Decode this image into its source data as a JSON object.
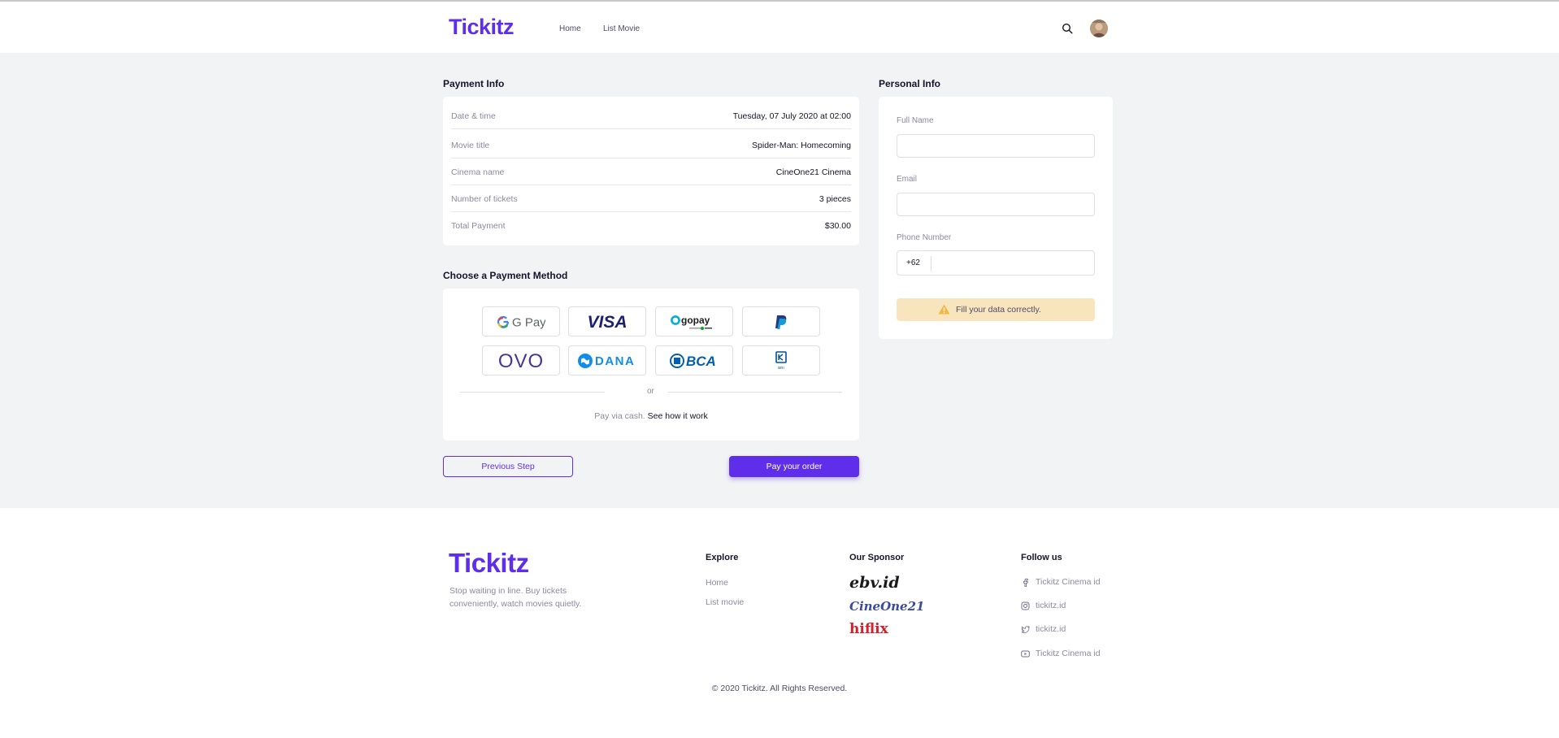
{
  "brand": {
    "name": "Tickitz",
    "color": "#5f2eea"
  },
  "navbar": {
    "links": [
      "Home",
      "List Movie"
    ],
    "search_icon": "search-icon",
    "avatar": "user-avatar"
  },
  "payment_info": {
    "title": "Payment Info",
    "rows": [
      {
        "label": "Date & time",
        "value": "Tuesday, 07 July 2020 at 02:00"
      },
      {
        "label": "Movie title",
        "value": "Spider-Man: Homecoming"
      },
      {
        "label": "Cinema name",
        "value": "CineOne21 Cinema"
      },
      {
        "label": "Number of tickets",
        "value": "3 pieces"
      },
      {
        "label": "Total Payment",
        "value": "$30.00"
      }
    ]
  },
  "payment_method": {
    "title": "Choose a Payment Method",
    "methods": [
      "G Pay",
      "VISA",
      "gopay",
      "PayPal",
      "OVO",
      "DANA",
      "BCA",
      "BRI"
    ],
    "divider_text": "or",
    "cash_text": "Pay via cash.",
    "cash_link": "See how it work"
  },
  "actions": {
    "previous": "Previous Step",
    "pay": "Pay your order"
  },
  "personal_info": {
    "title": "Personal Info",
    "full_name_label": "Full Name",
    "email_label": "Email",
    "phone_label": "Phone Number",
    "phone_prefix": "+62",
    "full_name_value": "",
    "email_value": "",
    "phone_value": "",
    "warning": "Fill your data correctly."
  },
  "footer": {
    "tagline": "Stop waiting in line. Buy tickets conveniently, watch movies quietly.",
    "explore": {
      "title": "Explore",
      "links": [
        "Home",
        "List movie"
      ]
    },
    "sponsor": {
      "title": "Our Sponsor",
      "items": [
        "ebv.id",
        "CineOne21",
        "hiflix"
      ]
    },
    "follow": {
      "title": "Follow us",
      "items": [
        {
          "icon": "facebook-icon",
          "label": "Tickitz Cinema id"
        },
        {
          "icon": "instagram-icon",
          "label": "tickitz.id"
        },
        {
          "icon": "twitter-icon",
          "label": "tickitz.id"
        },
        {
          "icon": "youtube-icon",
          "label": "Tickitz Cinema id"
        }
      ]
    },
    "copyright": "© 2020 Tickitz. All Rights Reserved."
  }
}
